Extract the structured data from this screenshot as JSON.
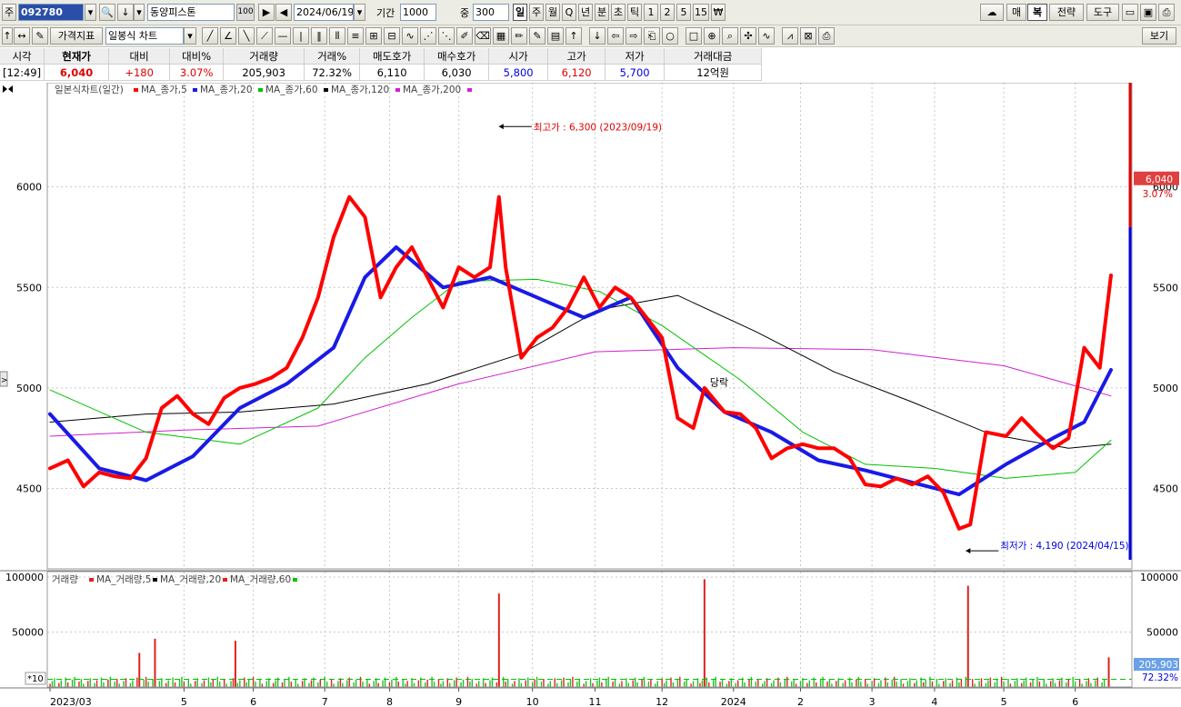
{
  "toolbar": {
    "market_label": "주",
    "code": "092780",
    "name": "동양피스톤",
    "badge": "100",
    "date": "2024/06/19",
    "period_label": "기간",
    "period": "1000",
    "count_label": "중",
    "count": "300",
    "intervals": [
      "일",
      "주",
      "월",
      "Q",
      "년",
      "분",
      "초",
      "틱",
      "1",
      "2",
      "5",
      "15",
      "₩"
    ],
    "right_buttons": [
      "매",
      "복",
      "전략",
      "도구"
    ],
    "view_button": "보기"
  },
  "toolbar2": {
    "indicator_label": "가격지표",
    "charttype_label": "일봉식 차트"
  },
  "quote": {
    "headers": [
      "시각",
      "현재가",
      "대비",
      "대비%",
      "거래량",
      "거래%",
      "매도호가",
      "매수호가",
      "시가",
      "고가",
      "저가",
      "거래대금"
    ],
    "values": [
      "[12:49]",
      "6,040",
      "+180",
      "3.07%",
      "205,903",
      "72.32%",
      "6,110",
      "6,030",
      "5,800",
      "6,120",
      "5,700",
      "12억원"
    ]
  },
  "colors": {
    "up": "#e00000",
    "down": "#0000e0",
    "ma5": "#ff0000",
    "ma20": "#1a1ae6",
    "ma60": "#00c000",
    "ma120": "#000000",
    "ma200": "#d020d0",
    "vol_up": "#e02020",
    "vol_down": "#20c020"
  },
  "chart_data": {
    "type": "line",
    "title": "일본식차트(일간)",
    "legend": [
      "MA_종가,5",
      "MA_종가,20",
      "MA_종가,60",
      "MA_종가,120",
      "MA_종가,200"
    ],
    "ylim": [
      4100,
      6500
    ],
    "yticks": [
      4500,
      5000,
      5500,
      6000
    ],
    "x_tick_labels": [
      "2023/03",
      "5",
      "6",
      "7",
      "8",
      "9",
      "10",
      "11",
      "12",
      "2024",
      "2",
      "3",
      "4",
      "5",
      "6"
    ],
    "x_ticks": [
      "2023-03-02",
      "2023-05-01",
      "2023-06-01",
      "2023-07-03",
      "2023-08-01",
      "2023-09-01",
      "2023-10-04",
      "2023-11-01",
      "2023-12-01",
      "2024-01-02",
      "2024-02-01",
      "2024-03-04",
      "2024-04-01",
      "2024-05-02",
      "2024-06-03"
    ],
    "x_range": [
      "2023-03-02",
      "2024-06-19"
    ],
    "series": [
      {
        "name": "MA_종가,5",
        "x": [
          "2023-03-02",
          "2023-03-10",
          "2023-03-17",
          "2023-03-24",
          "2023-03-31",
          "2023-04-07",
          "2023-04-14",
          "2023-04-21",
          "2023-04-28",
          "2023-05-05",
          "2023-05-12",
          "2023-05-19",
          "2023-05-26",
          "2023-06-02",
          "2023-06-09",
          "2023-06-16",
          "2023-06-23",
          "2023-06-30",
          "2023-07-07",
          "2023-07-14",
          "2023-07-21",
          "2023-07-28",
          "2023-08-04",
          "2023-08-11",
          "2023-08-18",
          "2023-08-25",
          "2023-09-01",
          "2023-09-08",
          "2023-09-15",
          "2023-09-19",
          "2023-09-22",
          "2023-09-29",
          "2023-10-06",
          "2023-10-13",
          "2023-10-20",
          "2023-10-27",
          "2023-11-03",
          "2023-11-10",
          "2023-11-17",
          "2023-11-24",
          "2023-12-01",
          "2023-12-08",
          "2023-12-15",
          "2023-12-20",
          "2023-12-29",
          "2024-01-05",
          "2024-01-12",
          "2024-01-19",
          "2024-01-26",
          "2024-02-02",
          "2024-02-09",
          "2024-02-16",
          "2024-02-23",
          "2024-03-01",
          "2024-03-08",
          "2024-03-15",
          "2024-03-22",
          "2024-03-29",
          "2024-04-05",
          "2024-04-12",
          "2024-04-17",
          "2024-04-24",
          "2024-05-03",
          "2024-05-10",
          "2024-05-17",
          "2024-05-24",
          "2024-05-31",
          "2024-06-07",
          "2024-06-14",
          "2024-06-19"
        ],
        "values": [
          4600,
          4640,
          4510,
          4580,
          4560,
          4550,
          4650,
          4900,
          4960,
          4870,
          4820,
          4950,
          5000,
          5020,
          5050,
          5100,
          5250,
          5450,
          5750,
          5950,
          5850,
          5450,
          5600,
          5700,
          5550,
          5400,
          5600,
          5550,
          5600,
          5950,
          5600,
          5150,
          5250,
          5300,
          5400,
          5550,
          5400,
          5500,
          5450,
          5350,
          5250,
          4850,
          4800,
          5000,
          4880,
          4870,
          4800,
          4650,
          4700,
          4720,
          4700,
          4700,
          4650,
          4520,
          4510,
          4550,
          4520,
          4560,
          4480,
          4300,
          4320,
          4780,
          4760,
          4850,
          4770,
          4700,
          4750,
          5200,
          5100,
          5560
        ]
      },
      {
        "name": "MA_종가,20",
        "x": [
          "2023-03-02",
          "2023-03-24",
          "2023-04-14",
          "2023-05-05",
          "2023-05-26",
          "2023-06-16",
          "2023-07-07",
          "2023-07-21",
          "2023-08-04",
          "2023-08-25",
          "2023-09-15",
          "2023-10-06",
          "2023-10-27",
          "2023-11-17",
          "2023-12-08",
          "2023-12-29",
          "2024-01-19",
          "2024-02-09",
          "2024-03-01",
          "2024-03-22",
          "2024-04-12",
          "2024-05-03",
          "2024-05-24",
          "2024-06-07",
          "2024-06-19"
        ],
        "values": [
          4870,
          4600,
          4540,
          4660,
          4900,
          5020,
          5200,
          5550,
          5700,
          5500,
          5550,
          5450,
          5350,
          5450,
          5100,
          4880,
          4780,
          4640,
          4590,
          4530,
          4470,
          4620,
          4750,
          4830,
          5090
        ]
      },
      {
        "name": "MA_종가,60",
        "x": [
          "2023-03-02",
          "2023-04-14",
          "2023-05-26",
          "2023-06-30",
          "2023-07-21",
          "2023-08-11",
          "2023-09-01",
          "2023-10-06",
          "2023-11-03",
          "2023-12-01",
          "2024-01-05",
          "2024-02-02",
          "2024-03-01",
          "2024-04-01",
          "2024-05-03",
          "2024-06-03",
          "2024-06-19"
        ],
        "values": [
          4990,
          4780,
          4720,
          4900,
          5150,
          5350,
          5530,
          5540,
          5480,
          5310,
          5040,
          4780,
          4620,
          4600,
          4550,
          4580,
          4740
        ]
      },
      {
        "name": "MA_종가,120",
        "x": [
          "2023-03-02",
          "2023-04-14",
          "2023-05-26",
          "2023-07-07",
          "2023-08-18",
          "2023-09-29",
          "2023-11-03",
          "2023-12-08",
          "2024-01-12",
          "2024-02-16",
          "2024-03-22",
          "2024-04-26",
          "2024-05-31",
          "2024-06-19"
        ],
        "values": [
          4830,
          4870,
          4880,
          4920,
          5020,
          5170,
          5390,
          5460,
          5280,
          5080,
          4930,
          4770,
          4700,
          4720
        ]
      },
      {
        "name": "MA_종가,200",
        "x": [
          "2023-03-02",
          "2023-05-01",
          "2023-06-30",
          "2023-09-01",
          "2023-11-01",
          "2024-01-02",
          "2024-03-04",
          "2024-05-02",
          "2024-06-19"
        ],
        "values": [
          4760,
          4790,
          4810,
          5020,
          5180,
          5200,
          5190,
          5110,
          4960
        ]
      }
    ],
    "annotations": [
      {
        "text": "최고가 : 6,300 (2023/09/19)",
        "x": "2023-09-19",
        "y": 6300
      },
      {
        "text": "최저가 : 4,190 (2024/04/15)",
        "x": "2024-04-15",
        "y": 4190
      },
      {
        "text": "당락",
        "x": "2023-12-20",
        "y": 5010
      }
    ],
    "current_price": {
      "price": "6,040",
      "change": "3.07%",
      "value": 6040
    },
    "volume": {
      "title": "거래량",
      "legend": [
        "MA_거래량,5",
        "MA_거래량,20",
        "MA_거래량,60"
      ],
      "ylim": [
        0,
        100000
      ],
      "yticks": [
        50000,
        100000
      ],
      "current": "205,903",
      "ratio": "72.32%",
      "unit_label": "*10",
      "spikes": [
        {
          "x": "2023-04-11",
          "value": 31000
        },
        {
          "x": "2023-04-18",
          "value": 44000
        },
        {
          "x": "2023-05-24",
          "value": 42000
        },
        {
          "x": "2023-09-19",
          "value": 85000
        },
        {
          "x": "2023-12-20",
          "value": 98000
        },
        {
          "x": "2024-04-16",
          "value": 92000
        },
        {
          "x": "2024-06-18",
          "value": 27000
        }
      ],
      "base_level": 5000
    }
  }
}
